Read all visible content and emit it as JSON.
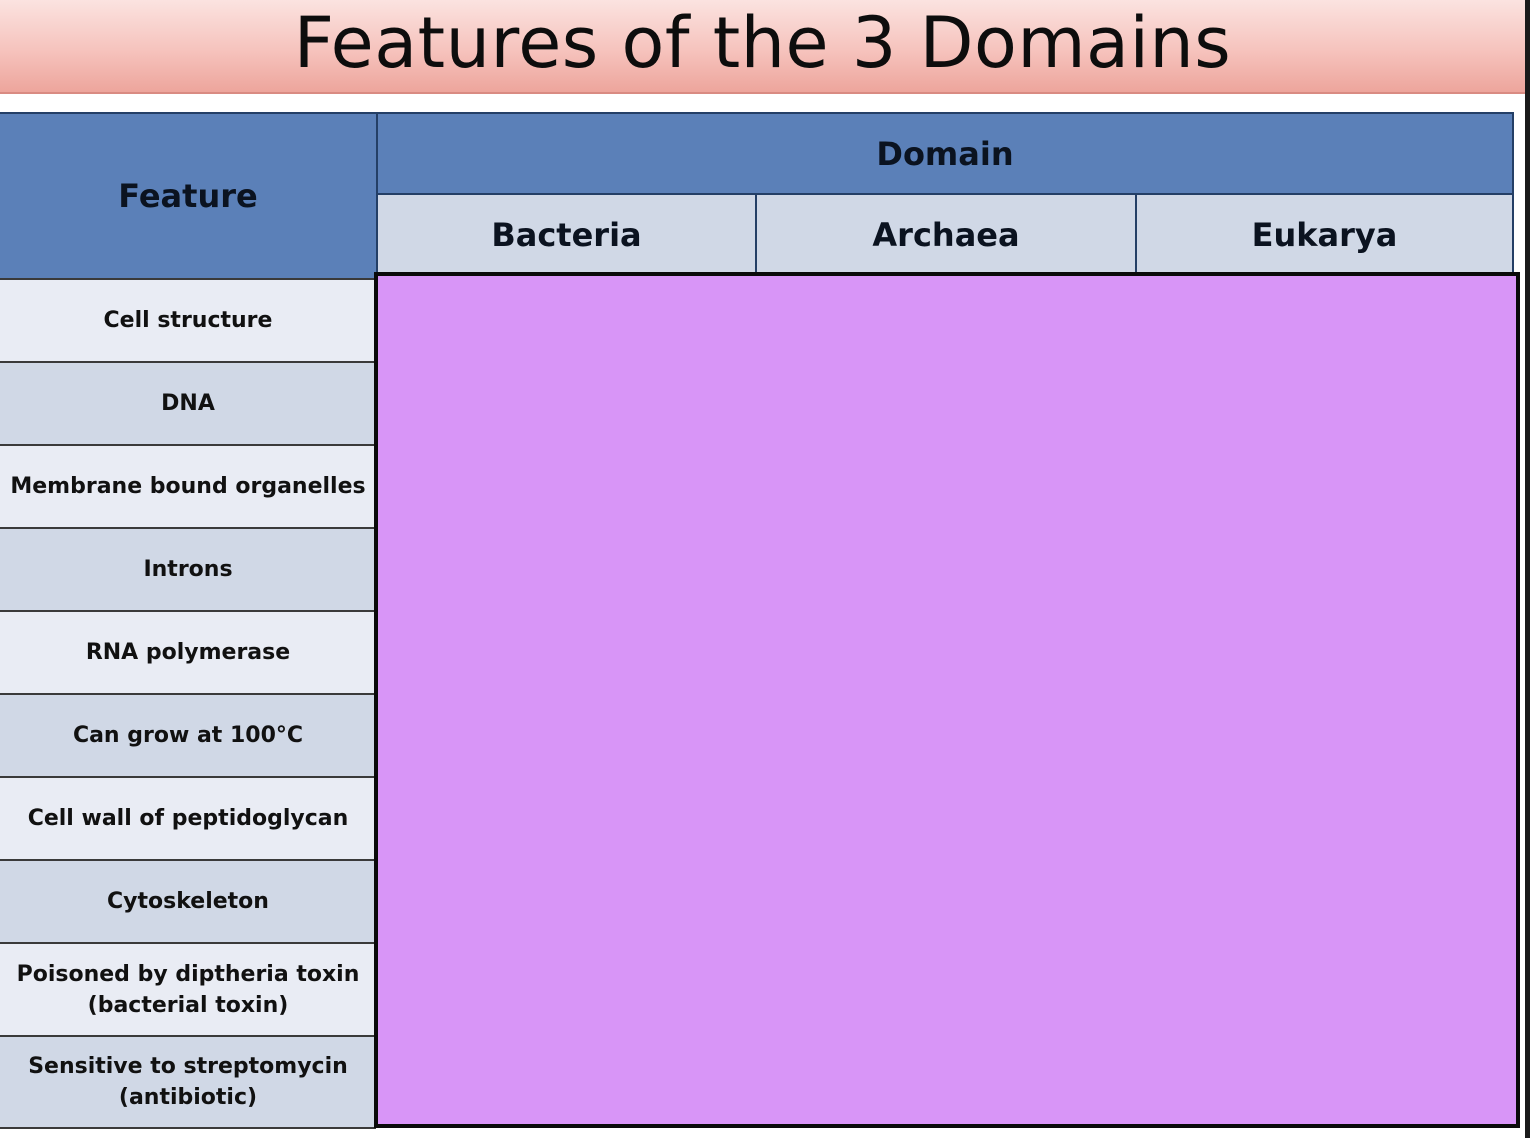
{
  "slide": {
    "title": "Features of the 3 Domains"
  },
  "table": {
    "feature_header": "Feature",
    "domain_header": "Domain",
    "domains": [
      "Bacteria",
      "Archaea",
      "Eukarya"
    ],
    "features": [
      "Cell structure",
      "DNA",
      "Membrane bound organelles",
      "Introns",
      "RNA polymerase",
      "Can grow at 100°C",
      "Cell wall of peptidoglycan",
      "Cytoskeleton",
      "Poisoned by diptheria toxin\n(bacterial toxin)",
      "Sensitive to streptomycin\n(antibiotic)"
    ]
  },
  "colors": {
    "title_gradient_top": "#fbe3e0",
    "title_gradient_bottom": "#eda59c",
    "header_blue": "#5b80b8",
    "subheader_blue": "#d0d8e6",
    "row_light": "#e9ecf4",
    "answer_cover_purple": "#d895f7"
  }
}
